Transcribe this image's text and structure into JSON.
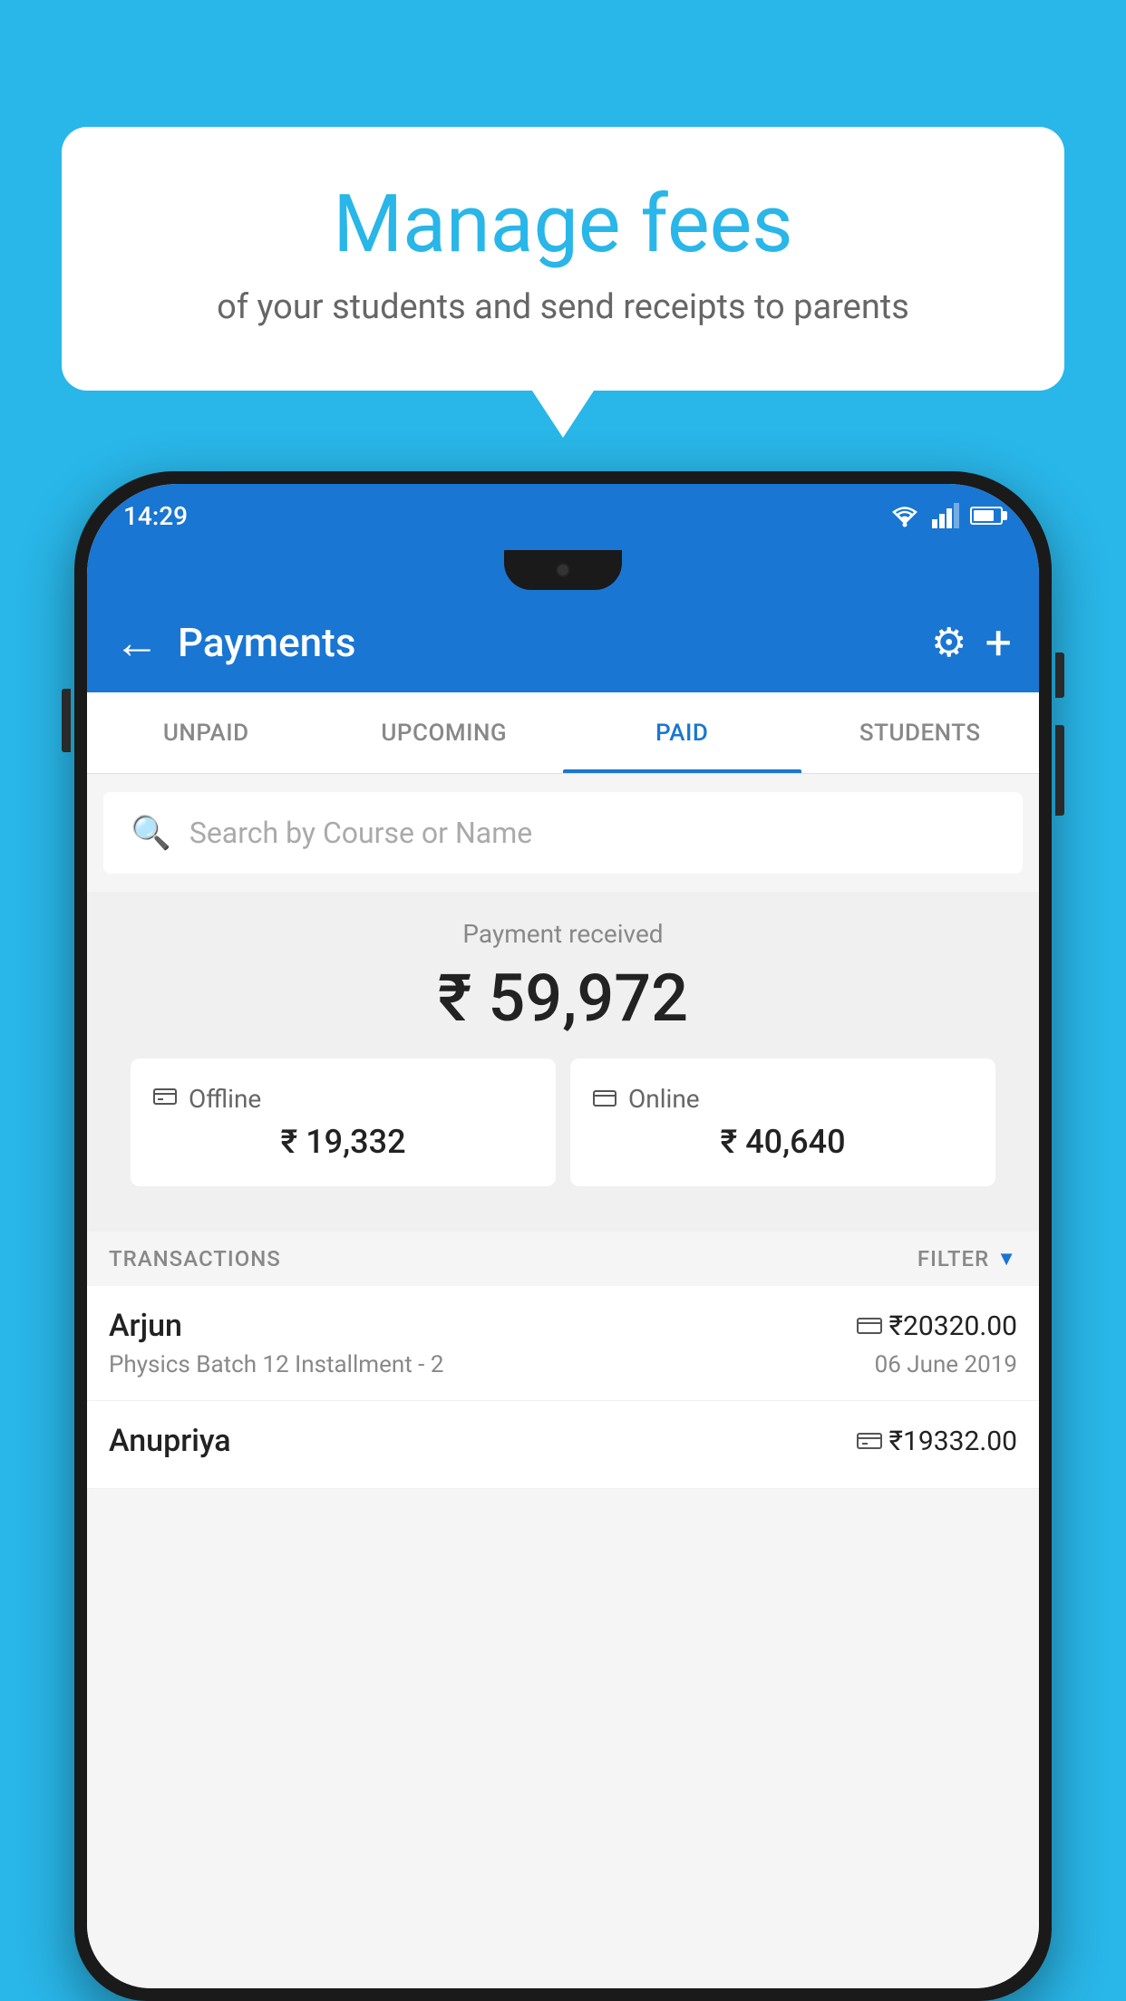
{
  "background_color": "#29b6e8",
  "bubble": {
    "title": "Manage fees",
    "subtitle": "of your students and send receipts to parents"
  },
  "phone": {
    "status_bar": {
      "time": "14:29"
    },
    "app_bar": {
      "title": "Payments",
      "back_label": "←",
      "plus_label": "+",
      "gear_label": "⚙"
    },
    "tabs": [
      {
        "label": "UNPAID",
        "active": false
      },
      {
        "label": "UPCOMING",
        "active": false
      },
      {
        "label": "PAID",
        "active": true
      },
      {
        "label": "STUDENTS",
        "active": false
      }
    ],
    "search": {
      "placeholder": "Search by Course or Name"
    },
    "payment_summary": {
      "label": "Payment received",
      "amount": "₹ 59,972"
    },
    "cards": [
      {
        "icon": "💳",
        "label": "Offline",
        "amount": "₹ 19,332"
      },
      {
        "icon": "💳",
        "label": "Online",
        "amount": "₹ 40,640"
      }
    ],
    "transactions_label": "TRANSACTIONS",
    "filter_label": "FILTER",
    "transactions": [
      {
        "name": "Arjun",
        "description": "Physics Batch 12 Installment - 2",
        "amount": "₹20320.00",
        "date": "06 June 2019",
        "icon": "card"
      },
      {
        "name": "Anupriya",
        "description": "",
        "amount": "₹19332.00",
        "date": "",
        "icon": "cash"
      }
    ]
  }
}
